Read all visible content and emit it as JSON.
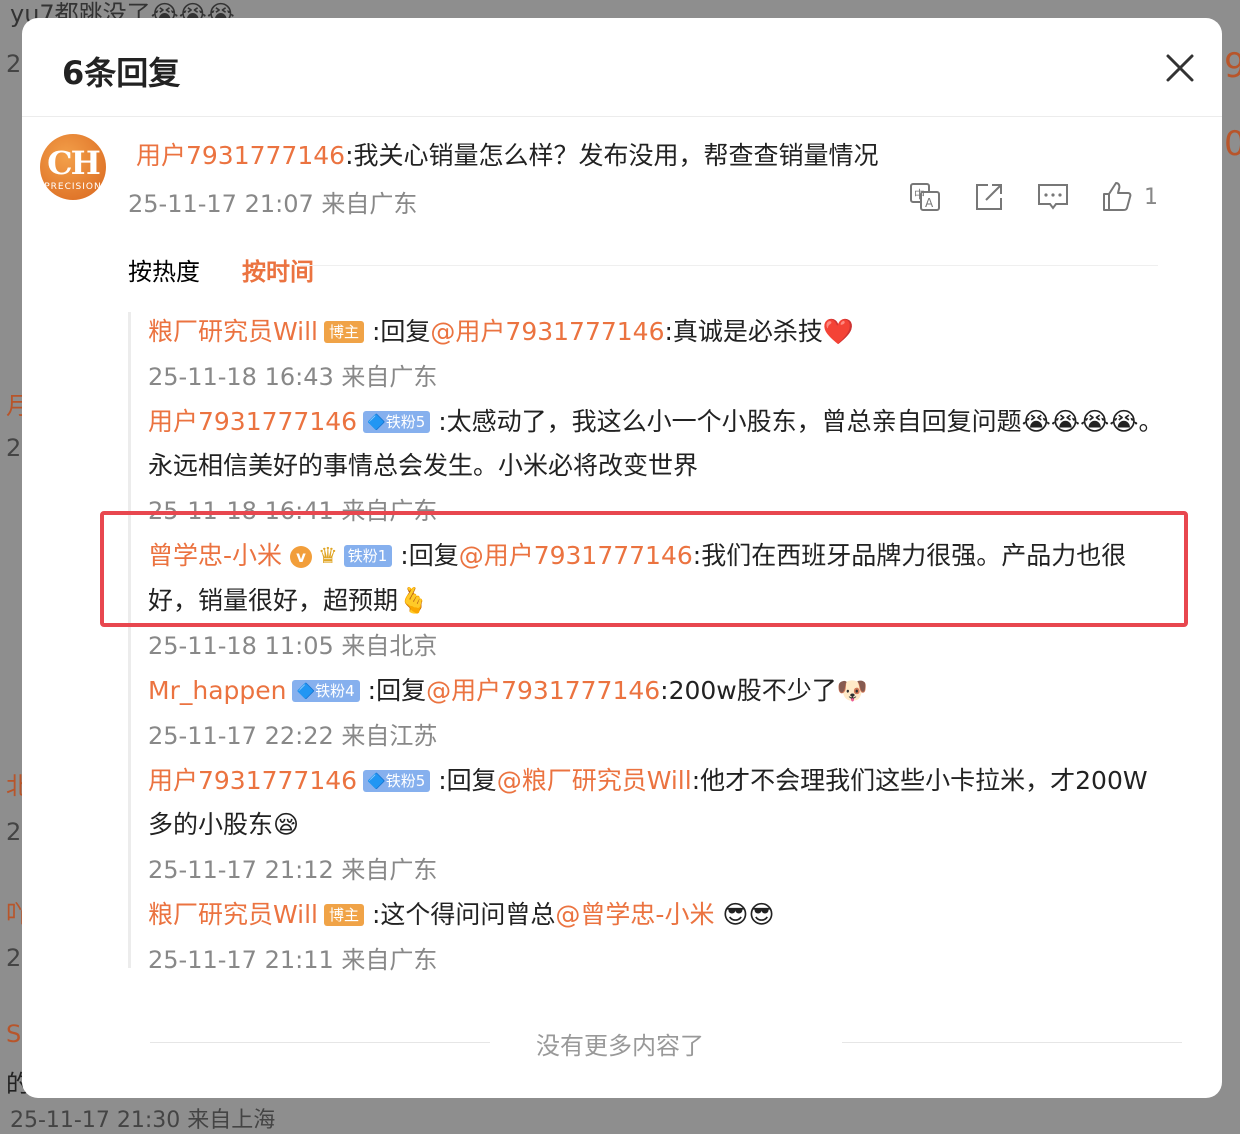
{
  "background": {
    "top_fragment": "yu7都跳没了😭😭😭",
    "left_fragments": [
      "2",
      "月",
      "2",
      "北",
      "2",
      "吖",
      "2",
      "S",
      "的"
    ],
    "right_fragments": [
      "9",
      "0"
    ],
    "bottom_fragment": "25-11-17 21:30 来自上海"
  },
  "modal": {
    "title": "6条回复",
    "close_icon": "close-icon"
  },
  "main_comment": {
    "user": "用户7931777146",
    "text": ":我关心销量怎么样？发布没用，帮查查销量情况",
    "meta": "25-11-17 21:07 来自广东",
    "avatar_text": "CH",
    "avatar_subtext": "PRECISION",
    "actions": {
      "translate_icon": "translate-icon",
      "share_icon": "share-icon",
      "comment_icon": "comment-icon",
      "like_icon": "thumbs-up-icon",
      "like_count": "1"
    }
  },
  "sort": {
    "by_heat": "按热度",
    "by_time": "按时间"
  },
  "replies": [
    {
      "user": "粮厂研究员Will",
      "role_badge": "博主",
      "prefix": ":回复",
      "mention": "@用户7931777146",
      "text": ":真诚是必杀技❤️",
      "meta": "25-11-18 16:43 来自广东"
    },
    {
      "user": "用户7931777146",
      "fan_badge": "🔷铁粉5",
      "text": ":太感动了，我这么小一个小股东，曾总亲自回复问题😭😭😭😭。永远相信美好的事情总会发生。小米必将改变世界",
      "meta": "25-11-18 16:41 来自广东"
    },
    {
      "user": "曾学忠-小米",
      "v_badge": "v",
      "fan_badge": "铁粉1",
      "prefix": ":回复",
      "mention": "@用户7931777146",
      "text": ":我们在西班牙品牌力很强。产品力也很好，销量很好，超预期🫰",
      "meta": "25-11-18 11:05 来自北京"
    },
    {
      "user": "Mr_happen",
      "fan_badge": "🔷铁粉4",
      "prefix": ":回复",
      "mention": "@用户7931777146",
      "text": ":200w股不少了🐶",
      "meta": "25-11-17 22:22 来自江苏"
    },
    {
      "user": "用户7931777146",
      "fan_badge": "🔷铁粉5",
      "prefix": ":回复",
      "mention": "@粮厂研究员Will",
      "text": ":他才不会理我们这些小卡拉米，才200W多的小股东😪",
      "meta": "25-11-17 21:12 来自广东"
    },
    {
      "user": "粮厂研究员Will",
      "role_badge": "博主",
      "text": ":这个得问问曾总",
      "mention": "@曾学忠-小米",
      "suffix": " 😎😎",
      "meta": "25-11-17 21:11 来自广东"
    }
  ],
  "footer": {
    "no_more": "没有更多内容了"
  },
  "colors": {
    "accent": "#eb7340",
    "highlight": "#e8474f"
  }
}
